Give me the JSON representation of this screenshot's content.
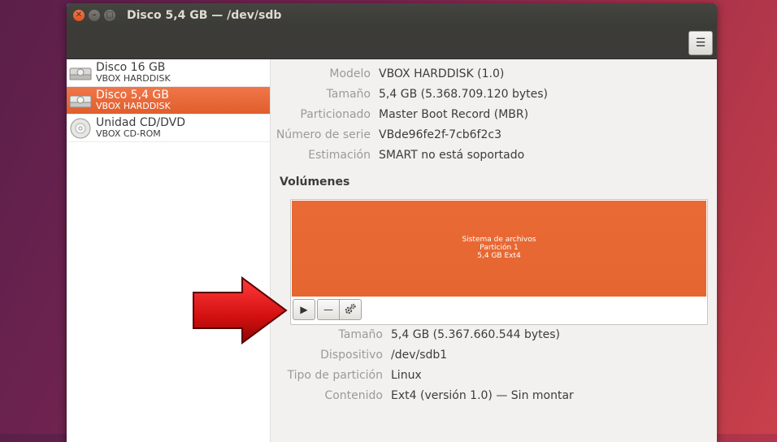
{
  "window": {
    "title": "Disco 5,4 GB — /dev/sdb"
  },
  "sidebar": {
    "drives": [
      {
        "name": "Disco 16 GB",
        "model": "VBOX HARDDISK",
        "icon": "hard-disk-icon"
      },
      {
        "name": "Disco 5,4 GB",
        "model": "VBOX HARDDISK",
        "icon": "hard-disk-icon",
        "selected": true
      },
      {
        "name": "Unidad CD/DVD",
        "model": "VBOX CD-ROM",
        "icon": "cd-dvd-icon"
      }
    ]
  },
  "disk": {
    "model_label": "Modelo",
    "model_value": "VBOX HARDDISK (1.0)",
    "size_label": "Tamaño",
    "size_value": "5,4 GB (5.368.709.120 bytes)",
    "partitioning_label": "Particionado",
    "partitioning_value": "Master Boot Record (MBR)",
    "serial_label": "Número de serie",
    "serial_value": "VBde96fe2f-7cb6f2c3",
    "assessment_label": "Estimación",
    "assessment_value": "SMART no está soportado"
  },
  "volumes": {
    "heading": "Volúmenes",
    "partition": {
      "line1": "Sistema de archivos",
      "line2": "Partición 1",
      "line3": "5,4 GB Ext4"
    }
  },
  "volume_details": {
    "size_label": "Tamaño",
    "size_value": "5,4 GB (5.367.660.544 bytes)",
    "device_label": "Dispositivo",
    "device_value": "/dev/sdb1",
    "type_label": "Tipo de partición",
    "type_value": "Linux",
    "contents_label": "Contenido",
    "contents_value": "Ext4 (versión 1.0) — Sin montar"
  },
  "colors": {
    "accent": "#e95420",
    "partition": "#e8692f",
    "arrow": "#d81414"
  }
}
